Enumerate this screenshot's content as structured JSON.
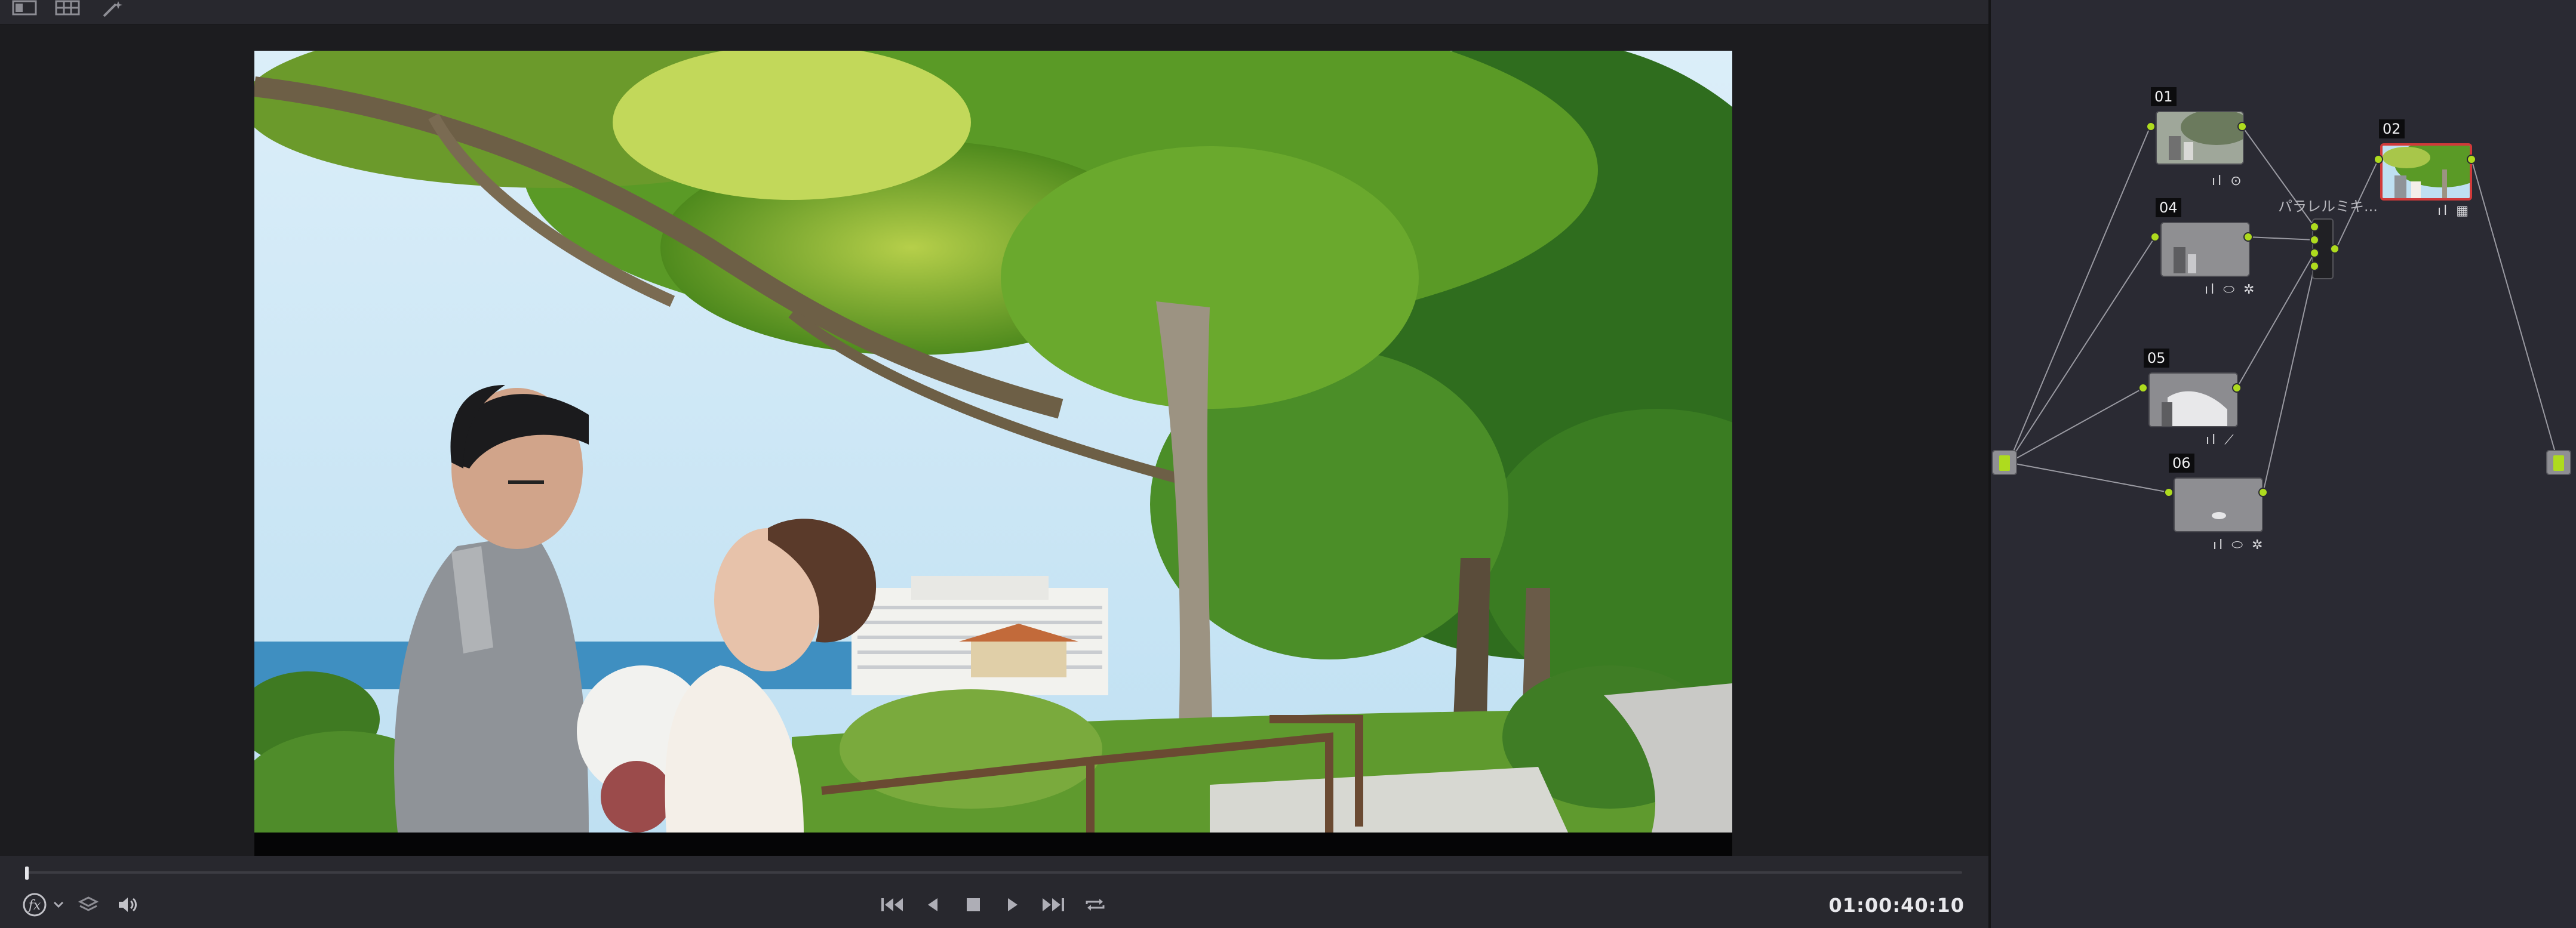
{
  "viewer": {
    "toolbar": {
      "icons": [
        "viewer-layout-icon",
        "grid-icon",
        "magic-wand-icon"
      ]
    },
    "transport": {
      "timecode": "01:00:40:10",
      "icons": [
        "fx-icon",
        "chevron-down-icon",
        "layers-icon",
        "speaker-icon",
        "skip-to-start-icon",
        "reverse-play-icon",
        "stop-icon",
        "play-icon",
        "skip-to-end-icon",
        "loop-icon"
      ]
    }
  },
  "node_editor": {
    "nodes": [
      {
        "label": "01",
        "tools": "ıl ⊙",
        "tools_icons": [
          "histogram-icon",
          "circle-icon"
        ]
      },
      {
        "label": "02",
        "tools": "ıl ▦",
        "tools_icons": [
          "histogram-icon",
          "grid-icon"
        ],
        "selected": true
      },
      {
        "label": "04",
        "tools": "ıl ⬭ ✲",
        "tools_icons": [
          "histogram-icon",
          "window-icon",
          "tracker-icon"
        ]
      },
      {
        "label": "05",
        "tools": "ıl ⟋",
        "tools_icons": [
          "histogram-icon",
          "qualifier-pen-icon"
        ]
      },
      {
        "label": "06",
        "tools": "ıl ⬭ ✲",
        "tools_icons": [
          "histogram-icon",
          "window-icon",
          "tracker-icon"
        ]
      }
    ],
    "mixer_label": "パラレルミキ..."
  },
  "colors": {
    "port_accent": "#aedb1e",
    "selected_border": "#d03a3a",
    "panel_bg": "#2a2a33"
  }
}
